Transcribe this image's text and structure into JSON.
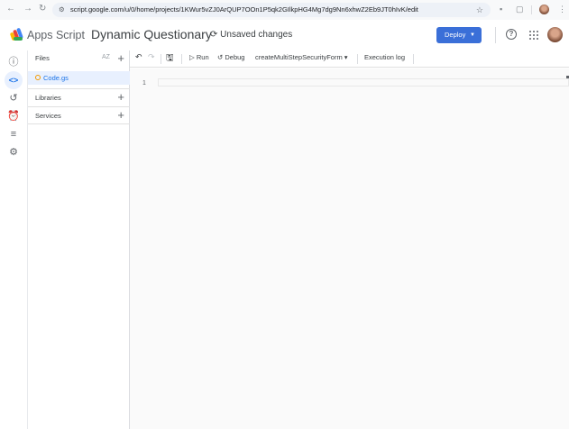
{
  "browser": {
    "url": "script.google.com/u/0/home/projects/1KWur5vZJ0ArQUP7OOn1P5qk2GIlkpHG4Mg7dg9Nn6xhwZ2Eb9JT0hIvK/edit"
  },
  "header": {
    "app_name": "Apps Script",
    "project_title": "Dynamic Questionary",
    "save_status": "Unsaved changes",
    "deploy_label": "Deploy",
    "help": "?"
  },
  "files_panel": {
    "files_label": "Files",
    "sort_label": "AZ",
    "files": [
      {
        "name": "Code.gs"
      }
    ],
    "libraries_label": "Libraries",
    "services_label": "Services"
  },
  "toolbar": {
    "run_label": "Run",
    "debug_label": "Debug",
    "function_select": "createMultiStepSecurityForm",
    "execution_log_label": "Execution log"
  },
  "editor": {
    "line_numbers": [
      "1"
    ]
  },
  "colors": {
    "accent": "#1a73e8",
    "deploy": "#3a6fd8"
  }
}
